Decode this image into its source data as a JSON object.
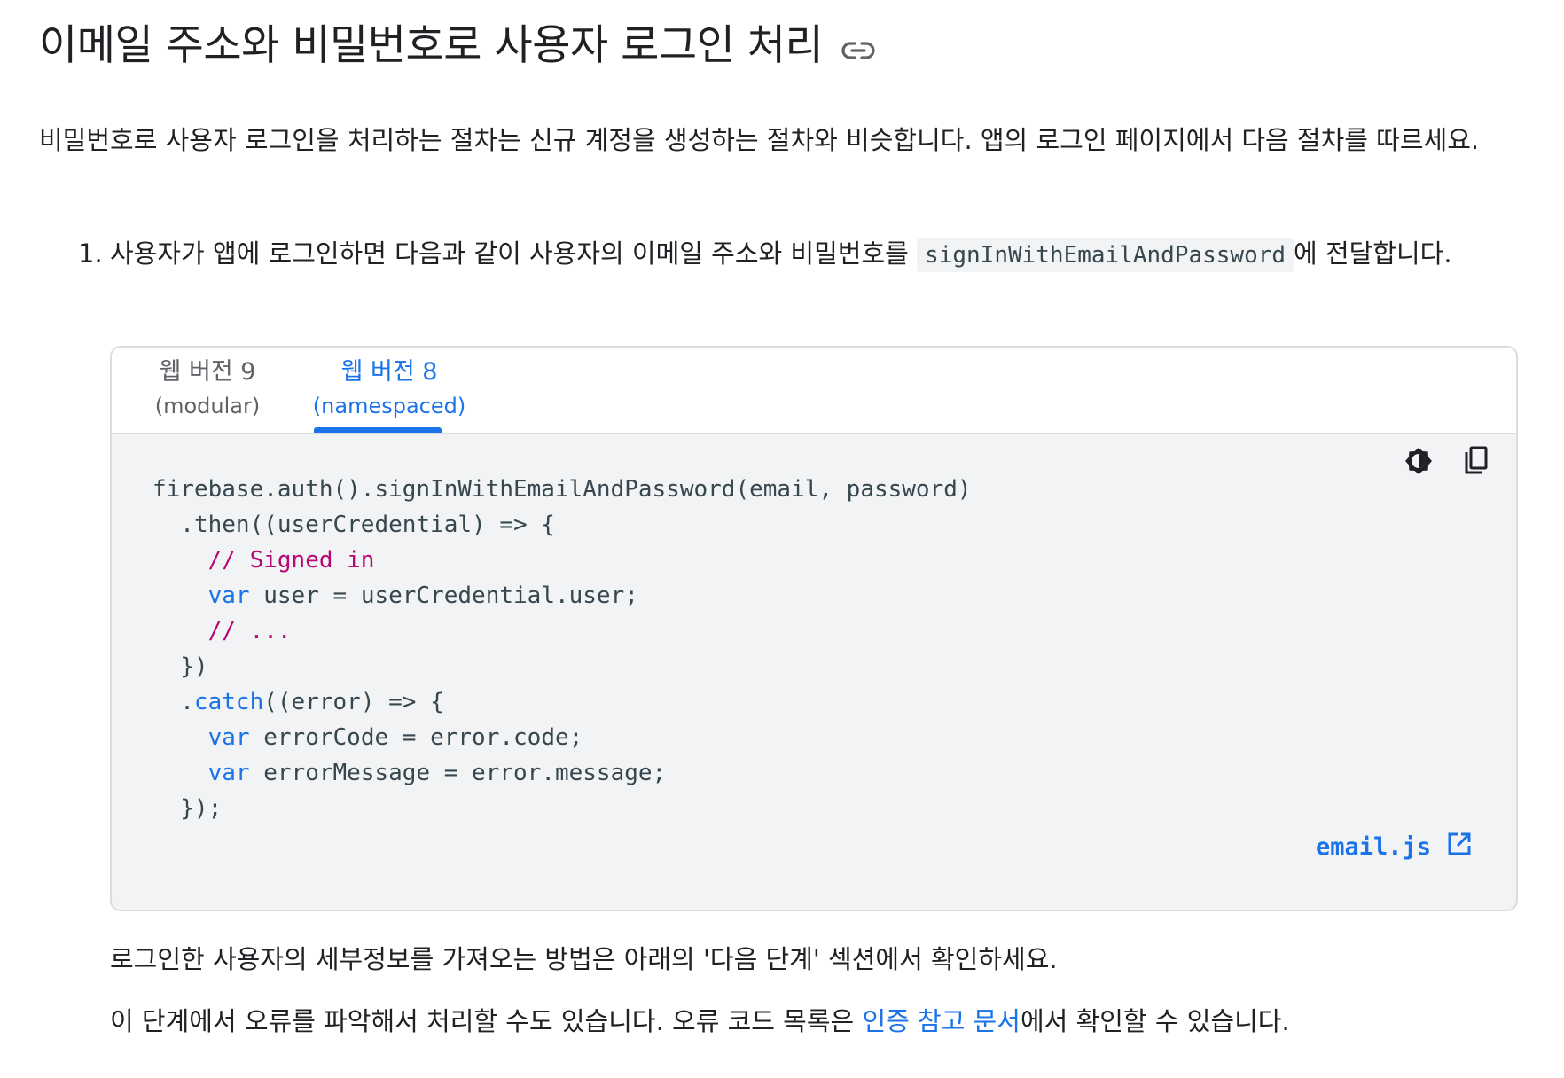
{
  "heading": {
    "title": "이메일 주소와 비밀번호로 사용자 로그인 처리",
    "link_icon": "link-icon"
  },
  "intro": "비밀번호로 사용자 로그인을 처리하는 절차는 신규 계정을 생성하는 절차와 비슷합니다. 앱의 로그인 페이지에서 다음 절차를 따르세요.",
  "step1": {
    "number": "1.",
    "text_before": "사용자가 앱에 로그인하면 다음과 같이 사용자의 이메일 주소와 비밀번호를 ",
    "code": "signInWithEmailAndPassword",
    "text_after": "에 전달합니다."
  },
  "tabs": [
    {
      "line1": "웹 버전 9",
      "line2": "(modular)",
      "active": false
    },
    {
      "line1": "웹 버전 8",
      "line2": "(namespaced)",
      "active": true
    }
  ],
  "code_tools": {
    "theme_icon": "brightness-icon",
    "copy_icon": "copy-icon"
  },
  "code_lines": [
    [
      {
        "t": "firebase.auth().signInWithEmailAndPassword(email, password)"
      }
    ],
    [
      {
        "t": "  .then((userCredential) => {"
      }
    ],
    [
      {
        "t": "    "
      },
      {
        "t": "// Signed in",
        "c": "cm"
      }
    ],
    [
      {
        "t": "    "
      },
      {
        "t": "var",
        "c": "kw"
      },
      {
        "t": " user = userCredential.user;"
      }
    ],
    [
      {
        "t": "    "
      },
      {
        "t": "// ...",
        "c": "cm"
      }
    ],
    [
      {
        "t": "  })"
      }
    ],
    [
      {
        "t": "  ."
      },
      {
        "t": "catch",
        "c": "kw"
      },
      {
        "t": "((error) => {"
      }
    ],
    [
      {
        "t": "    "
      },
      {
        "t": "var",
        "c": "kw"
      },
      {
        "t": " errorCode = error.code;"
      }
    ],
    [
      {
        "t": "    "
      },
      {
        "t": "var",
        "c": "kw"
      },
      {
        "t": " errorMessage = error.message;"
      }
    ],
    [
      {
        "t": "  });"
      }
    ]
  ],
  "file_link": {
    "label": "email.js",
    "icon": "open-in-new-icon"
  },
  "para1": "로그인한 사용자의 세부정보를 가져오는 방법은 아래의 '다음 단계' 섹션에서 확인하세요.",
  "para2": {
    "before": "이 단계에서 오류를 파악해서 처리할 수도 있습니다. 오류 코드 목록은 ",
    "link": "인증 참고 문서",
    "after": "에서 확인할 수 있습니다."
  },
  "colors": {
    "accent": "#1a73e8",
    "comment": "#b80672",
    "code_bg": "#f1f3f4",
    "text": "#202124"
  }
}
